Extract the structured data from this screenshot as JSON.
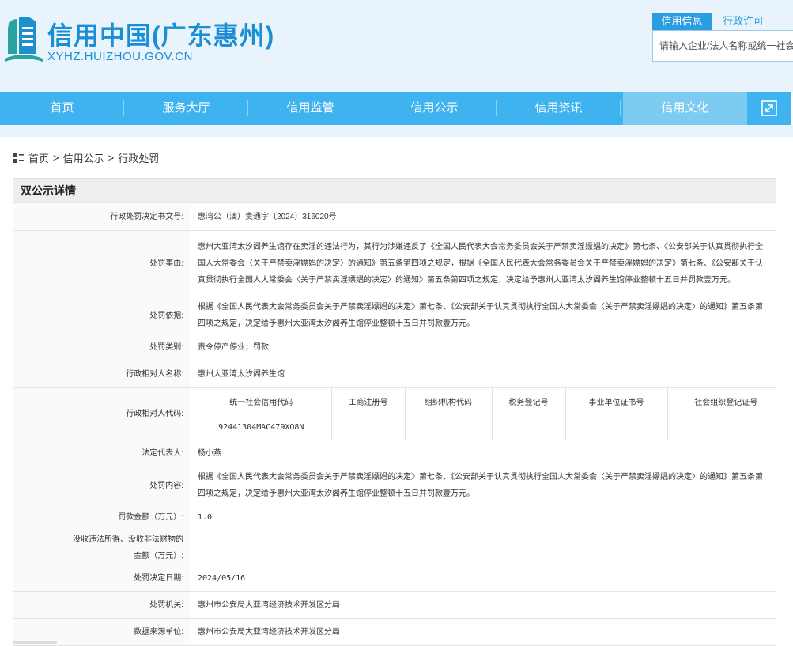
{
  "header": {
    "site_title": "信用中国(广东惠州)",
    "site_domain": "XYHZ.HUIZHOU.GOV.CN",
    "search_tabs": [
      "信用信息",
      "行政许可"
    ],
    "search_placeholder": "请输入企业/法人名称或统一社会信用代码"
  },
  "nav": {
    "items": [
      "首页",
      "服务大厅",
      "信用监管",
      "信用公示",
      "信用资讯",
      "信用文化"
    ],
    "active_index": 5,
    "expand_icon": "expand-icon"
  },
  "breadcrumb": {
    "icon": "grid-icon",
    "items": [
      "首页",
      "信用公示",
      "行政处罚"
    ],
    "separator": ">"
  },
  "panel": {
    "title": "双公示详情"
  },
  "detail": {
    "decision_no": {
      "label": "行政处罚决定书文号:",
      "value": "惠湾公（澳）责通字〔2024〕316020号"
    },
    "reason": {
      "label": "处罚事由:",
      "value": "惠州大亚湾太汐阁养生馆存在卖淫的违法行为，其行为涉嫌违反了《全国人民代表大会常务委员会关于严禁卖淫嫖娼的决定》第七条、《公安部关于认真贯彻执行全国人大常委会〈关于严禁卖淫嫖娼的决定〉的通知》第五条第四项之规定，根据《全国人民代表大会常务委员会关于严禁卖淫嫖娼的决定》第七条、《公安部关于认真贯彻执行全国人大常委会〈关于严禁卖淫嫖娼的决定〉的通知》第五条第四项之规定，决定给予惠州大亚湾太汐阁养生馆停业整顿十五日并罚款壹万元。"
    },
    "basis": {
      "label": "处罚依据:",
      "value": "根据《全国人民代表大会常务委员会关于严禁卖淫嫖娼的决定》第七条、《公安部关于认真贯彻执行全国人大常委会〈关于严禁卖淫嫖娼的决定〉的通知》第五条第四项之规定，决定给予惠州大亚湾太汐阁养生馆停业整顿十五日并罚款壹万元。"
    },
    "category": {
      "label": "处罚类别:",
      "value": "责令停产停业；罚款"
    },
    "party_name": {
      "label": "行政相对人名称:",
      "value": "惠州大亚湾太汐阁养生馆"
    },
    "party_code": {
      "label": "行政相对人代码:",
      "headers": [
        "统一社会信用代码",
        "工商注册号",
        "组织机构代码",
        "税务登记号",
        "事业单位证书号",
        "社会组织登记证号"
      ],
      "values": [
        "92441304MAC479XQ8N",
        "",
        "",
        "",
        "",
        ""
      ]
    },
    "legal_rep": {
      "label": "法定代表人:",
      "value": "杨小燕"
    },
    "content": {
      "label": "处罚内容:",
      "value": "根据《全国人民代表大会常务委员会关于严禁卖淫嫖娼的决定》第七条、《公安部关于认真贯彻执行全国人大常委会〈关于严禁卖淫嫖娼的决定〉的通知》第五条第四项之规定，决定给予惠州大亚湾太汐阁养生馆停业整顿十五日并罚款壹万元。"
    },
    "fine": {
      "label": "罚款金额（万元）:",
      "value": "1.0"
    },
    "confiscation": {
      "label_line1": "没收违法所得、没收非法财物的",
      "label_line2": "金额（万元）:",
      "value": ""
    },
    "date": {
      "label": "处罚决定日期:",
      "value": "2024/05/16"
    },
    "authority": {
      "label": "处罚机关:",
      "value": "惠州市公安局大亚湾经济技术开发区分局"
    },
    "source": {
      "label": "数据来源单位:",
      "value": "惠州市公安局大亚湾经济技术开发区分局"
    }
  }
}
